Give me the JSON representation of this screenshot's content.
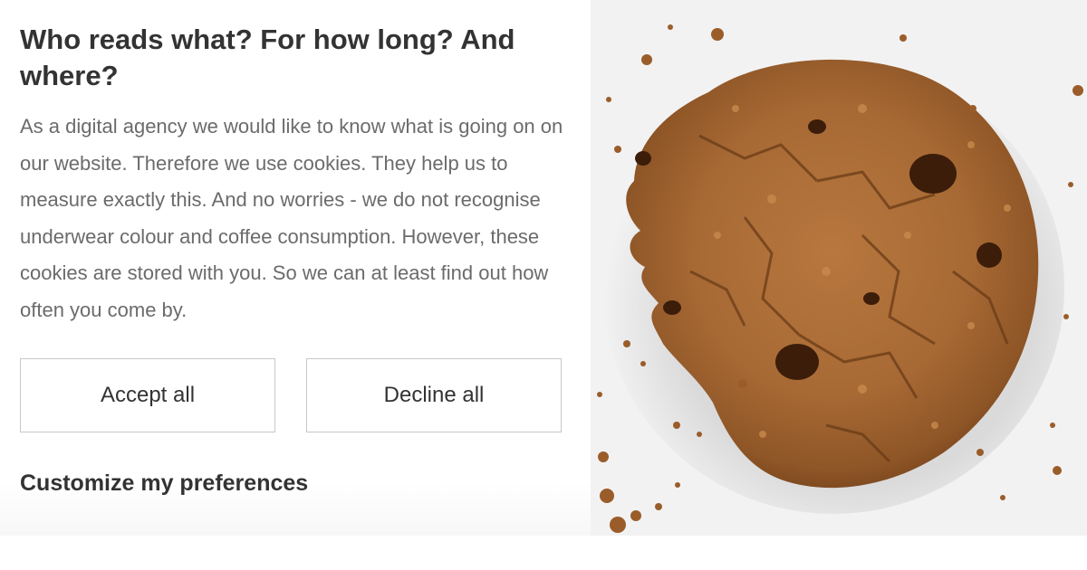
{
  "banner": {
    "title": "Who reads what? For how long? And where?",
    "body": "As a digital agency we would like to know what is going on on our website. Therefore we use cookies. They help us to measure exactly this. And no worries - we do not recognise underwear colour and coffee consumption. However, these cookies are stored with you. So we can at least find out how often you come by.",
    "accept_label": "Accept all",
    "decline_label": "Decline all",
    "customize_label": "Customize my preferences"
  },
  "image": {
    "subject": "chocolate-chip-cookie-photo"
  },
  "colors": {
    "title": "#333333",
    "body": "#6b6b6b",
    "button_border": "#c8c8c8",
    "cookie": "#a86a35",
    "photo_background": "#f2f2f3"
  }
}
